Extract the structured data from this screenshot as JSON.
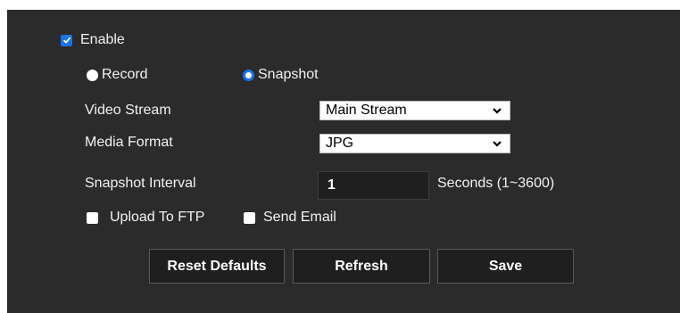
{
  "enable": {
    "label": "Enable",
    "checked": true
  },
  "mode": {
    "record_label": "Record",
    "snapshot_label": "Snapshot",
    "selected": "Snapshot"
  },
  "video_stream": {
    "label": "Video Stream",
    "value": "Main Stream"
  },
  "media_format": {
    "label": "Media Format",
    "value": "JPG"
  },
  "snapshot_interval": {
    "label": "Snapshot Interval",
    "value": "1",
    "unit": "Seconds (1~3600)"
  },
  "upload_ftp": {
    "label": "Upload To FTP",
    "checked": false
  },
  "send_email": {
    "label": "Send Email",
    "checked": false
  },
  "buttons": {
    "reset": "Reset Defaults",
    "refresh": "Refresh",
    "save": "Save"
  },
  "colors": {
    "panel": "#2b2b2b",
    "accent": "#1a73e8",
    "button": "#1f1f1f"
  }
}
